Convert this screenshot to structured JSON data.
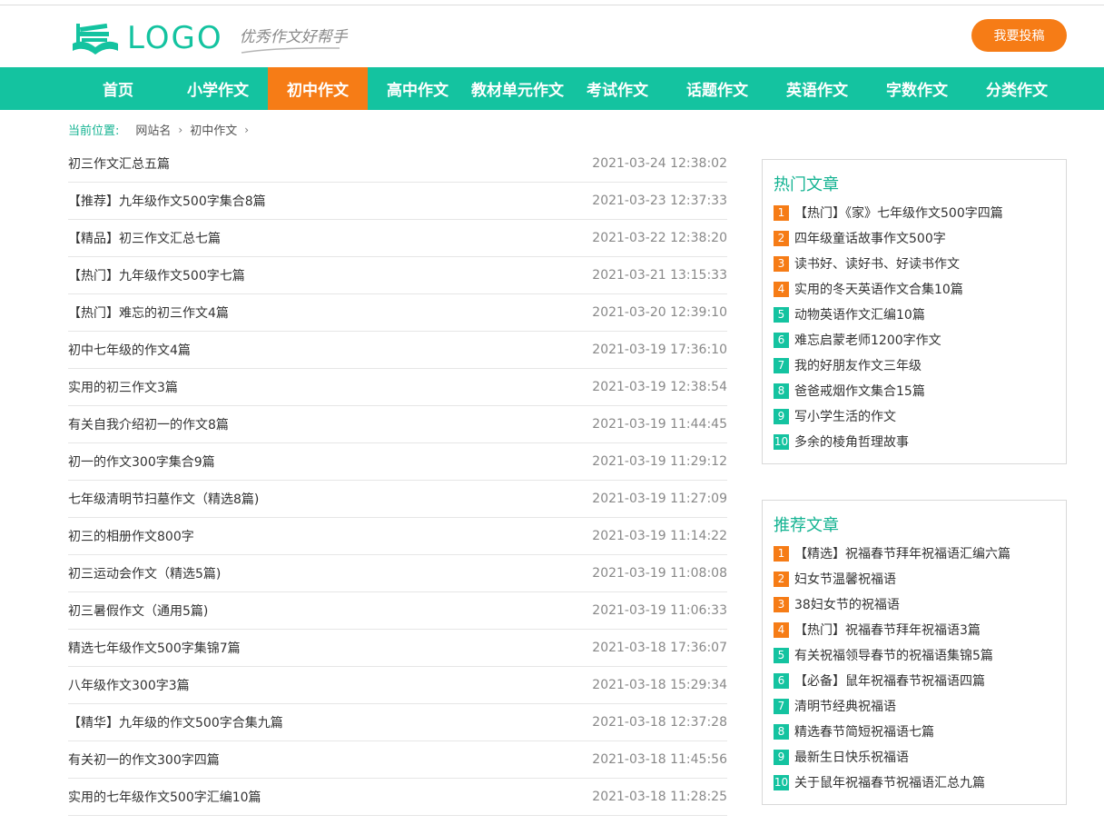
{
  "header": {
    "logo_text": "LOGO",
    "slogan": "优秀作文好帮手",
    "submit_label": "我要投稿"
  },
  "nav": {
    "items": [
      "首页",
      "小学作文",
      "初中作文",
      "高中作文",
      "教材单元作文",
      "考试作文",
      "话题作文",
      "英语作文",
      "字数作文",
      "分类作文"
    ],
    "active_index": 2
  },
  "breadcrumb": {
    "label": "当前位置:",
    "items": [
      "网站名",
      "初中作文"
    ]
  },
  "articles": [
    {
      "title": "初三作文汇总五篇",
      "time": "2021-03-24 12:38:02"
    },
    {
      "title": "【推荐】九年级作文500字集合8篇",
      "time": "2021-03-23 12:37:33"
    },
    {
      "title": "【精品】初三作文汇总七篇",
      "time": "2021-03-22 12:38:20"
    },
    {
      "title": "【热门】九年级作文500字七篇",
      "time": "2021-03-21 13:15:33"
    },
    {
      "title": "【热门】难忘的初三作文4篇",
      "time": "2021-03-20 12:39:10"
    },
    {
      "title": "初中七年级的作文4篇",
      "time": "2021-03-19 17:36:10"
    },
    {
      "title": "实用的初三作文3篇",
      "time": "2021-03-19 12:38:54"
    },
    {
      "title": "有关自我介绍初一的作文8篇",
      "time": "2021-03-19 11:44:45"
    },
    {
      "title": "初一的作文300字集合9篇",
      "time": "2021-03-19 11:29:12"
    },
    {
      "title": "七年级清明节扫墓作文（精选8篇)",
      "time": "2021-03-19 11:27:09"
    },
    {
      "title": "初三的相册作文800字",
      "time": "2021-03-19 11:14:22"
    },
    {
      "title": "初三运动会作文（精选5篇)",
      "time": "2021-03-19 11:08:08"
    },
    {
      "title": "初三暑假作文（通用5篇)",
      "time": "2021-03-19 11:06:33"
    },
    {
      "title": "精选七年级作文500字集锦7篇",
      "time": "2021-03-18 17:36:07"
    },
    {
      "title": "八年级作文300字3篇",
      "time": "2021-03-18 15:29:34"
    },
    {
      "title": "【精华】九年级的作文500字合集九篇",
      "time": "2021-03-18 12:37:28"
    },
    {
      "title": "有关初一的作文300字四篇",
      "time": "2021-03-18 11:45:56"
    },
    {
      "title": "实用的七年级作文500字汇编10篇",
      "time": "2021-03-18 11:28:25"
    }
  ],
  "hot": {
    "title": "热门文章",
    "items": [
      {
        "num": "1",
        "title": "【热门】《家》七年级作文500字四篇"
      },
      {
        "num": "2",
        "title": "四年级童话故事作文500字"
      },
      {
        "num": "3",
        "title": "读书好、读好书、好读书作文"
      },
      {
        "num": "4",
        "title": "实用的冬天英语作文合集10篇"
      },
      {
        "num": "5",
        "title": "动物英语作文汇编10篇"
      },
      {
        "num": "6",
        "title": "难忘启蒙老师1200字作文"
      },
      {
        "num": "7",
        "title": "我的好朋友作文三年级"
      },
      {
        "num": "8",
        "title": "爸爸戒烟作文集合15篇"
      },
      {
        "num": "9",
        "title": "写小学生活的作文"
      },
      {
        "num": "10",
        "title": "多余的棱角哲理故事"
      }
    ]
  },
  "recommended": {
    "title": "推荐文章",
    "items": [
      {
        "num": "1",
        "title": "【精选】祝福春节拜年祝福语汇编六篇"
      },
      {
        "num": "2",
        "title": "妇女节温馨祝福语"
      },
      {
        "num": "3",
        "title": "38妇女节的祝福语"
      },
      {
        "num": "4",
        "title": "【热门】祝福春节拜年祝福语3篇"
      },
      {
        "num": "5",
        "title": "有关祝福领导春节的祝福语集锦5篇"
      },
      {
        "num": "6",
        "title": "【必备】鼠年祝福春节祝福语四篇"
      },
      {
        "num": "7",
        "title": "清明节经典祝福语"
      },
      {
        "num": "8",
        "title": "精选春节简短祝福语七篇"
      },
      {
        "num": "9",
        "title": "最新生日快乐祝福语"
      },
      {
        "num": "10",
        "title": "关于鼠年祝福春节祝福语汇总九篇"
      }
    ]
  },
  "colors": {
    "primary": "#14c3a0",
    "accent": "#f67c16"
  }
}
